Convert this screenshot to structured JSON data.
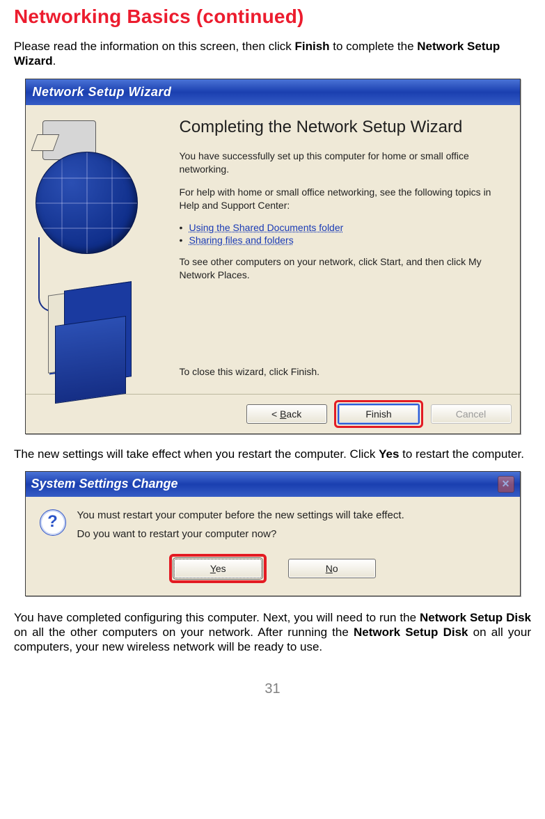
{
  "page": {
    "title": "Networking Basics (continued)",
    "intro_before": "Please read the information on this screen, then click ",
    "intro_bold1": "Finish",
    "intro_mid": " to complete the ",
    "intro_bold2": "Network Setup Wizard",
    "intro_end": "."
  },
  "wizard": {
    "title": "Network Setup Wizard",
    "heading": "Completing the Network Setup Wizard",
    "p1": "You have successfully set up this computer for home or small office networking.",
    "p2": "For help with home or small office networking, see the following topics in Help and Support Center:",
    "links": [
      "Using the Shared Documents folder",
      "Sharing files and folders"
    ],
    "p3": "To see other computers on your network, click Start, and then click My Network Places.",
    "p_close": "To close this wizard, click Finish.",
    "back_prefix": "< ",
    "back_u": "B",
    "back_rest": "ack",
    "finish": "Finish",
    "cancel": "Cancel"
  },
  "mid_text": {
    "before": "The new settings will take effect when you restart the computer.  Click ",
    "bold": "Yes",
    "after": " to restart the computer."
  },
  "dialog": {
    "title": "System Settings Change",
    "line1": "You must restart your computer before the new settings will take effect.",
    "line2": "Do you want to restart your computer now?",
    "yes_u": "Y",
    "yes_rest": "es",
    "no_u": "N",
    "no_rest": "o"
  },
  "closing": {
    "t1": "You have completed configuring this computer.  Next, you will need to run the ",
    "b1": "Network Setup Disk",
    "t2": " on all the other computers on your network.  After running the ",
    "b2": "Network Setup Disk",
    "t3": " on all your computers, your new wireless network will be ready to use."
  },
  "page_number": "31"
}
